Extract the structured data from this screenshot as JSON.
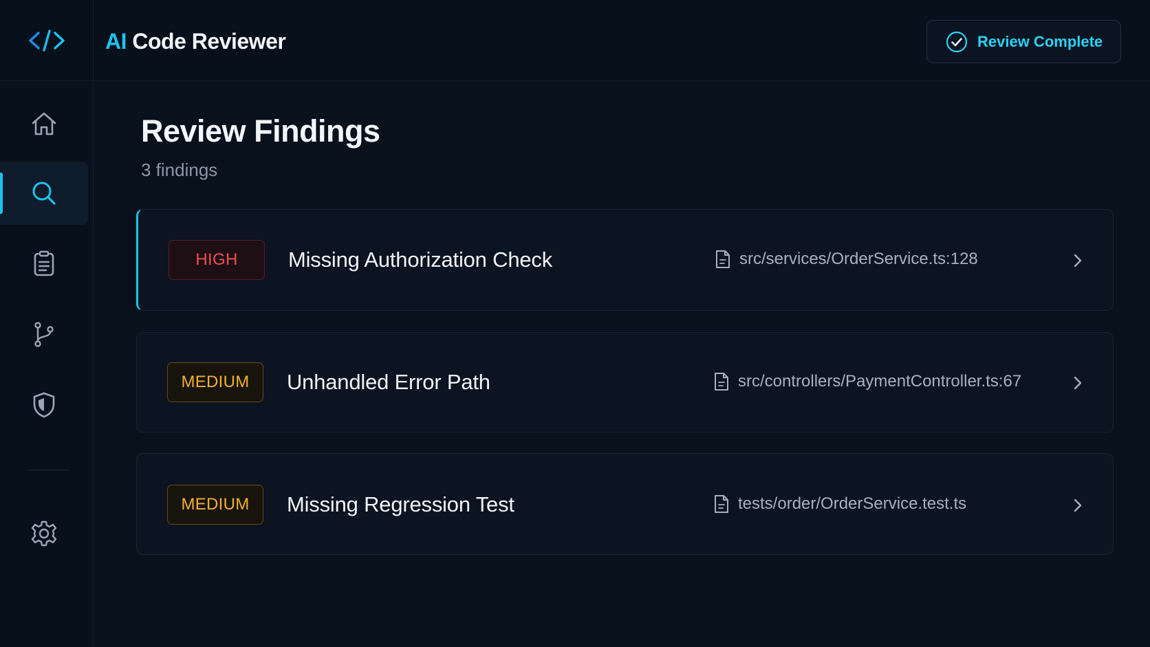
{
  "header": {
    "title_ai": "AI",
    "title_rest": " Code Reviewer",
    "status_label": "Review Complete"
  },
  "sidebar": {
    "items": [
      {
        "name": "home",
        "icon": "home-icon",
        "active": false
      },
      {
        "name": "review",
        "icon": "search-icon",
        "active": true
      },
      {
        "name": "reports",
        "icon": "clipboard-icon",
        "active": false
      },
      {
        "name": "branches",
        "icon": "git-branch-icon",
        "active": false
      },
      {
        "name": "security",
        "icon": "shield-icon",
        "active": false
      },
      {
        "name": "settings",
        "icon": "gear-icon",
        "active": false
      }
    ]
  },
  "main": {
    "title": "Review Findings",
    "count_label": "3 findings",
    "findings": [
      {
        "severity": "HIGH",
        "title": "Missing Authorization Check",
        "file": "src/services/OrderService.ts:128"
      },
      {
        "severity": "MEDIUM",
        "title": "Unhandled Error Path",
        "file": "src/controllers/PaymentController.ts:67"
      },
      {
        "severity": "MEDIUM",
        "title": "Missing Regression Test",
        "file": "tests/order/OrderService.test.ts"
      }
    ]
  },
  "colors": {
    "accent": "#1cc4ee",
    "high": "#f14e4e",
    "medium": "#f5b030",
    "background": "#08111c"
  }
}
